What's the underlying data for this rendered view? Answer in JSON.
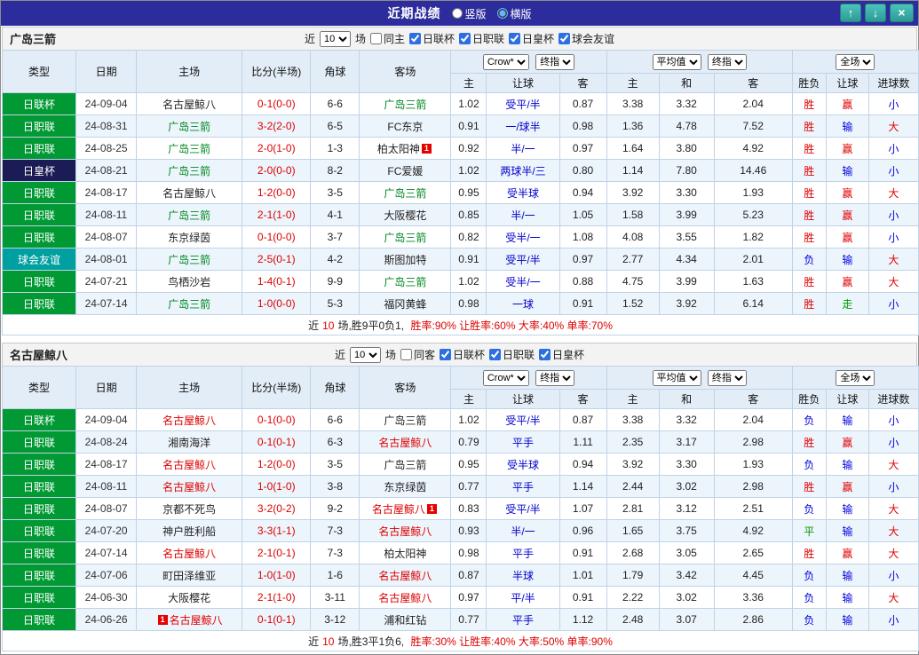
{
  "titlebar": {
    "title": "近期战绩",
    "vertical_label": "竖版",
    "horizontal_label": "横版",
    "selected_layout": "横版",
    "up_icon": "↑",
    "down_icon": "↓",
    "close_icon": "×",
    "bar_color": "#2c2c9c",
    "button_color": "#3cb4ae"
  },
  "table_headers": {
    "main": [
      "类型",
      "日期",
      "主场",
      "比分(半场)",
      "角球",
      "客场"
    ],
    "odds_sub": [
      "主",
      "让球",
      "客"
    ],
    "avg_sub": [
      "主",
      "和",
      "客"
    ],
    "result_sub": [
      "胜负",
      "让球",
      "进球数"
    ]
  },
  "selects": {
    "company": "Crow*",
    "company_time": "终指",
    "average": "平均值",
    "average_time": "终指",
    "scope": "全场"
  },
  "colors": {
    "league_green": "#019934",
    "league_navy": "#1b1b55",
    "league_teal": "#00a0a0",
    "win_red": "#e00000",
    "lose_blue": "#0000dd",
    "draw_green": "#009900"
  },
  "sections": [
    {
      "team": "广岛三箭",
      "filter": {
        "near": "近",
        "count": "10",
        "unit": "场",
        "same": "同主",
        "same_checked": false,
        "leagues": [
          "日联杯",
          "日职联",
          "日皇杯",
          "球会友谊"
        ]
      },
      "rows": [
        {
          "league": "日联杯",
          "lgc": "green",
          "date": "24-09-04",
          "home": "名古屋鲸八",
          "hc": "",
          "score": "0-1(0-0)",
          "corner": "6-6",
          "away": "广岛三箭",
          "ac": "t-green",
          "odds": [
            "1.02",
            "受平/半",
            "0.87"
          ],
          "avg": [
            "3.38",
            "3.32",
            "2.04"
          ],
          "result": "胜",
          "rc": "c-red",
          "asian": "赢",
          "hrc": "c-red",
          "goals": "小",
          "gc": "c-blue"
        },
        {
          "league": "日职联",
          "lgc": "green",
          "date": "24-08-31",
          "home": "广岛三箭",
          "hc": "t-green",
          "score": "3-2(2-0)",
          "corner": "6-5",
          "away": "FC东京",
          "ac": "",
          "odds": [
            "0.91",
            "一/球半",
            "0.98"
          ],
          "avg": [
            "1.36",
            "4.78",
            "7.52"
          ],
          "result": "胜",
          "rc": "c-red",
          "asian": "输",
          "hrc": "c-blue",
          "goals": "大",
          "gc": "c-red"
        },
        {
          "league": "日职联",
          "lgc": "green",
          "date": "24-08-25",
          "home": "广岛三箭",
          "hc": "t-green",
          "score": "2-0(1-0)",
          "corner": "1-3",
          "away": "柏太阳神",
          "ac": "",
          "apost": "1",
          "odds": [
            "0.92",
            "半/一",
            "0.97"
          ],
          "avg": [
            "1.64",
            "3.80",
            "4.92"
          ],
          "result": "胜",
          "rc": "c-red",
          "asian": "赢",
          "hrc": "c-red",
          "goals": "小",
          "gc": "c-blue"
        },
        {
          "league": "日皇杯",
          "lgc": "navy",
          "date": "24-08-21",
          "home": "广岛三箭",
          "hc": "t-green",
          "score": "2-0(0-0)",
          "corner": "8-2",
          "away": "FC爱媛",
          "ac": "",
          "odds": [
            "1.02",
            "两球半/三",
            "0.80"
          ],
          "avg": [
            "1.14",
            "7.80",
            "14.46"
          ],
          "result": "胜",
          "rc": "c-red",
          "asian": "输",
          "hrc": "c-blue",
          "goals": "小",
          "gc": "c-blue"
        },
        {
          "league": "日职联",
          "lgc": "green",
          "date": "24-08-17",
          "home": "名古屋鲸八",
          "hc": "",
          "score": "1-2(0-0)",
          "corner": "3-5",
          "away": "广岛三箭",
          "ac": "t-green",
          "odds": [
            "0.95",
            "受半球",
            "0.94"
          ],
          "avg": [
            "3.92",
            "3.30",
            "1.93"
          ],
          "result": "胜",
          "rc": "c-red",
          "asian": "赢",
          "hrc": "c-red",
          "goals": "大",
          "gc": "c-red"
        },
        {
          "league": "日职联",
          "lgc": "green",
          "date": "24-08-11",
          "home": "广岛三箭",
          "hc": "t-green",
          "score": "2-1(1-0)",
          "corner": "4-1",
          "away": "大阪樱花",
          "ac": "",
          "odds": [
            "0.85",
            "半/一",
            "1.05"
          ],
          "avg": [
            "1.58",
            "3.99",
            "5.23"
          ],
          "result": "胜",
          "rc": "c-red",
          "asian": "赢",
          "hrc": "c-red",
          "goals": "小",
          "gc": "c-blue"
        },
        {
          "league": "日职联",
          "lgc": "green",
          "date": "24-08-07",
          "home": "东京绿茵",
          "hc": "",
          "score": "0-1(0-0)",
          "corner": "3-7",
          "away": "广岛三箭",
          "ac": "t-green",
          "odds": [
            "0.82",
            "受半/一",
            "1.08"
          ],
          "avg": [
            "4.08",
            "3.55",
            "1.82"
          ],
          "result": "胜",
          "rc": "c-red",
          "asian": "赢",
          "hrc": "c-red",
          "goals": "小",
          "gc": "c-blue"
        },
        {
          "league": "球会友谊",
          "lgc": "teal",
          "date": "24-08-01",
          "home": "广岛三箭",
          "hc": "t-green",
          "score": "2-5(0-1)",
          "corner": "4-2",
          "away": "斯图加特",
          "ac": "",
          "odds": [
            "0.91",
            "受平/半",
            "0.97"
          ],
          "avg": [
            "2.77",
            "4.34",
            "2.01"
          ],
          "result": "负",
          "rc": "c-blue",
          "asian": "输",
          "hrc": "c-blue",
          "goals": "大",
          "gc": "c-red"
        },
        {
          "league": "日职联",
          "lgc": "green",
          "date": "24-07-21",
          "home": "鸟栖沙岩",
          "hc": "",
          "score": "1-4(0-1)",
          "corner": "9-9",
          "away": "广岛三箭",
          "ac": "t-green",
          "odds": [
            "1.02",
            "受半/一",
            "0.88"
          ],
          "avg": [
            "4.75",
            "3.99",
            "1.63"
          ],
          "result": "胜",
          "rc": "c-red",
          "asian": "赢",
          "hrc": "c-red",
          "goals": "大",
          "gc": "c-red"
        },
        {
          "league": "日职联",
          "lgc": "green",
          "date": "24-07-14",
          "home": "广岛三箭",
          "hc": "t-green",
          "score": "1-0(0-0)",
          "corner": "5-3",
          "away": "福冈黄蜂",
          "ac": "",
          "odds": [
            "0.98",
            "一球",
            "0.91"
          ],
          "avg": [
            "1.52",
            "3.92",
            "6.14"
          ],
          "result": "胜",
          "rc": "c-red",
          "asian": "走",
          "hrc": "c-green",
          "goals": "小",
          "gc": "c-blue"
        }
      ],
      "summary": [
        {
          "text": "近",
          "color": "#222222"
        },
        {
          "text": "10",
          "color": "#dd0000"
        },
        {
          "text": "场,胜9平0负1, ",
          "color": "#222222"
        },
        {
          "text": "胜率:90% 让胜率:60% 大率:40% 单率:70%",
          "color": "#dd0000"
        }
      ]
    },
    {
      "team": "名古屋鲸八",
      "filter": {
        "near": "近",
        "count": "10",
        "unit": "场",
        "same": "同客",
        "same_checked": false,
        "leagues": [
          "日联杯",
          "日职联",
          "日皇杯"
        ]
      },
      "rows": [
        {
          "league": "日联杯",
          "lgc": "green",
          "date": "24-09-04",
          "home": "名古屋鲸八",
          "hc": "t-red",
          "score": "0-1(0-0)",
          "corner": "6-6",
          "away": "广岛三箭",
          "ac": "",
          "odds": [
            "1.02",
            "受平/半",
            "0.87"
          ],
          "avg": [
            "3.38",
            "3.32",
            "2.04"
          ],
          "result": "负",
          "rc": "c-blue",
          "asian": "输",
          "hrc": "c-blue",
          "goals": "小",
          "gc": "c-blue"
        },
        {
          "league": "日职联",
          "lgc": "green",
          "date": "24-08-24",
          "home": "湘南海洋",
          "hc": "",
          "score": "0-1(0-1)",
          "corner": "6-3",
          "away": "名古屋鲸八",
          "ac": "t-red",
          "odds": [
            "0.79",
            "平手",
            "1.11"
          ],
          "avg": [
            "2.35",
            "3.17",
            "2.98"
          ],
          "result": "胜",
          "rc": "c-red",
          "asian": "赢",
          "hrc": "c-red",
          "goals": "小",
          "gc": "c-blue"
        },
        {
          "league": "日职联",
          "lgc": "green",
          "date": "24-08-17",
          "home": "名古屋鲸八",
          "hc": "t-red",
          "score": "1-2(0-0)",
          "corner": "3-5",
          "away": "广岛三箭",
          "ac": "",
          "odds": [
            "0.95",
            "受半球",
            "0.94"
          ],
          "avg": [
            "3.92",
            "3.30",
            "1.93"
          ],
          "result": "负",
          "rc": "c-blue",
          "asian": "输",
          "hrc": "c-blue",
          "goals": "大",
          "gc": "c-red"
        },
        {
          "league": "日职联",
          "lgc": "green",
          "date": "24-08-11",
          "home": "名古屋鲸八",
          "hc": "t-red",
          "score": "1-0(1-0)",
          "corner": "3-8",
          "away": "东京绿茵",
          "ac": "",
          "odds": [
            "0.77",
            "平手",
            "1.14"
          ],
          "avg": [
            "2.44",
            "3.02",
            "2.98"
          ],
          "result": "胜",
          "rc": "c-red",
          "asian": "赢",
          "hrc": "c-red",
          "goals": "小",
          "gc": "c-blue"
        },
        {
          "league": "日职联",
          "lgc": "green",
          "date": "24-08-07",
          "home": "京都不死鸟",
          "hc": "",
          "score": "3-2(0-2)",
          "corner": "9-2",
          "away": "名古屋鲸八",
          "ac": "t-red",
          "apost": "1",
          "odds": [
            "0.83",
            "受平/半",
            "1.07"
          ],
          "avg": [
            "2.81",
            "3.12",
            "2.51"
          ],
          "result": "负",
          "rc": "c-blue",
          "asian": "输",
          "hrc": "c-blue",
          "goals": "大",
          "gc": "c-red"
        },
        {
          "league": "日职联",
          "lgc": "green",
          "date": "24-07-20",
          "home": "神户胜利船",
          "hc": "",
          "score": "3-3(1-1)",
          "corner": "7-3",
          "away": "名古屋鲸八",
          "ac": "t-red",
          "odds": [
            "0.93",
            "半/一",
            "0.96"
          ],
          "avg": [
            "1.65",
            "3.75",
            "4.92"
          ],
          "result": "平",
          "rc": "c-green",
          "asian": "输",
          "hrc": "c-blue",
          "goals": "大",
          "gc": "c-red"
        },
        {
          "league": "日职联",
          "lgc": "green",
          "date": "24-07-14",
          "home": "名古屋鲸八",
          "hc": "t-red",
          "score": "2-1(0-1)",
          "corner": "7-3",
          "away": "柏太阳神",
          "ac": "",
          "odds": [
            "0.98",
            "平手",
            "0.91"
          ],
          "avg": [
            "2.68",
            "3.05",
            "2.65"
          ],
          "result": "胜",
          "rc": "c-red",
          "asian": "赢",
          "hrc": "c-red",
          "goals": "大",
          "gc": "c-red"
        },
        {
          "league": "日职联",
          "lgc": "green",
          "date": "24-07-06",
          "home": "町田泽维亚",
          "hc": "",
          "score": "1-0(1-0)",
          "corner": "1-6",
          "away": "名古屋鲸八",
          "ac": "t-red",
          "odds": [
            "0.87",
            "半球",
            "1.01"
          ],
          "avg": [
            "1.79",
            "3.42",
            "4.45"
          ],
          "result": "负",
          "rc": "c-blue",
          "asian": "输",
          "hrc": "c-blue",
          "goals": "小",
          "gc": "c-blue"
        },
        {
          "league": "日职联",
          "lgc": "green",
          "date": "24-06-30",
          "home": "大阪樱花",
          "hc": "",
          "score": "2-1(1-0)",
          "corner": "3-11",
          "away": "名古屋鲸八",
          "ac": "t-red",
          "odds": [
            "0.97",
            "平/半",
            "0.91"
          ],
          "avg": [
            "2.22",
            "3.02",
            "3.36"
          ],
          "result": "负",
          "rc": "c-blue",
          "asian": "输",
          "hrc": "c-blue",
          "goals": "大",
          "gc": "c-red"
        },
        {
          "league": "日职联",
          "lgc": "green",
          "date": "24-06-26",
          "home": "名古屋鲸八",
          "hc": "t-red",
          "hpre": "1",
          "score": "0-1(0-1)",
          "corner": "3-12",
          "away": "浦和红钻",
          "ac": "",
          "odds": [
            "0.77",
            "平手",
            "1.12"
          ],
          "avg": [
            "2.48",
            "3.07",
            "2.86"
          ],
          "result": "负",
          "rc": "c-blue",
          "asian": "输",
          "hrc": "c-blue",
          "goals": "小",
          "gc": "c-blue"
        }
      ],
      "summary": [
        {
          "text": "近",
          "color": "#222222"
        },
        {
          "text": "10",
          "color": "#dd0000"
        },
        {
          "text": "场,胜3平1负6, ",
          "color": "#222222"
        },
        {
          "text": "胜率:30% 让胜率:40% 大率:50% 单率:90%",
          "color": "#dd0000"
        }
      ]
    }
  ]
}
